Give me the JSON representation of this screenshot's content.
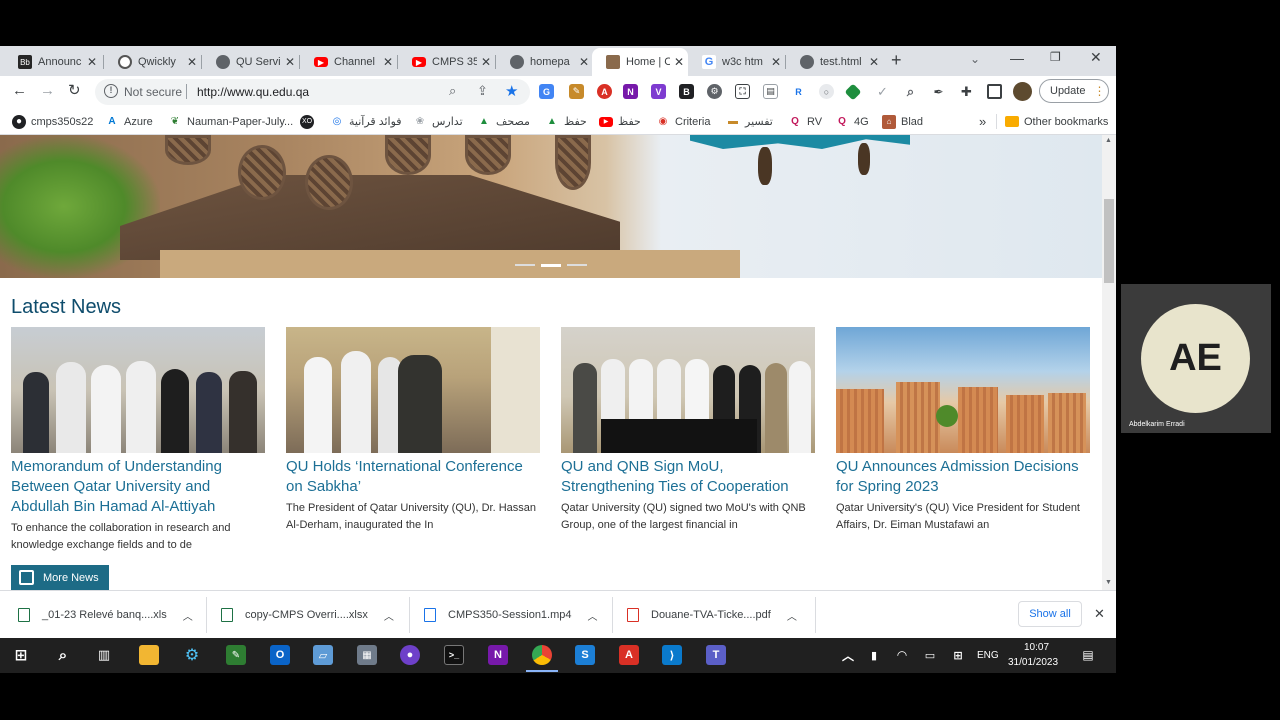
{
  "tabs": [
    {
      "label": "Announc",
      "icon": "bb-icon",
      "color": "#222"
    },
    {
      "label": "Qwickly",
      "icon": "q-icon",
      "color": "#fff"
    },
    {
      "label": "QU Servi",
      "icon": "globe-icon",
      "color": "#5f6368"
    },
    {
      "label": "Channel",
      "icon": "youtube-icon",
      "color": "#ff0000"
    },
    {
      "label": "CMPS 35",
      "icon": "youtube-icon",
      "color": "#ff0000"
    },
    {
      "label": "homepa",
      "icon": "globe-icon",
      "color": "#5f6368"
    },
    {
      "label": "Home | C",
      "icon": "qu-icon",
      "color": "#8a6a4c"
    },
    {
      "label": "w3c htm",
      "icon": "google-icon",
      "color": "#fff"
    },
    {
      "label": "test.html",
      "icon": "globe-icon",
      "color": "#5f6368"
    }
  ],
  "toolbar": {
    "not_secure": "Not secure",
    "url": "http://www.qu.edu.qa",
    "update": "Update"
  },
  "bookmarks": [
    {
      "label": "cmps350s22",
      "icon": "github-icon"
    },
    {
      "label": "Azure",
      "icon": "azure-icon"
    },
    {
      "label": "Nauman-Paper-July...",
      "icon": "leaf-icon"
    },
    {
      "label": "",
      "icon": "xo-icon"
    },
    {
      "label": "فوائد قرآنية",
      "icon": "tajweed-icon"
    },
    {
      "label": "تدارس",
      "icon": "book-icon"
    },
    {
      "label": "مصحف",
      "icon": "mushaf-icon"
    },
    {
      "label": "حفظ",
      "icon": "hifz-icon"
    },
    {
      "label": "حفظ",
      "icon": "youtube-icon"
    },
    {
      "label": "Criteria",
      "icon": "abet-icon"
    },
    {
      "label": "تفسير",
      "icon": "tafsir-icon"
    },
    {
      "label": "RV",
      "icon": "rv-icon"
    },
    {
      "label": "4G",
      "icon": "fourg-icon"
    },
    {
      "label": "Blad",
      "icon": "blad-icon"
    }
  ],
  "other_bookmarks": "Other bookmarks",
  "news": {
    "title": "Latest News",
    "items": [
      {
        "title": "Memorandum of Understanding Between Qatar University and Abdullah Bin Hamad Al-Attiyah",
        "excerpt": "To enhance the collaboration in research and knowledge exchange fields and to de"
      },
      {
        "title": "QU Holds ‘International Conference on Sabkha’",
        "excerpt": "The President of Qatar University (QU), Dr. Hassan Al-Derham, inaugurated the In"
      },
      {
        "title": "QU and QNB Sign MoU, Strengthening Ties of Cooperation",
        "excerpt": "Qatar University (QU) signed two MoU's with QNB Group, one of the largest financial in"
      },
      {
        "title": "QU Announces Admission Decisions for Spring 2023",
        "excerpt": "Qatar University's (QU) Vice President for Student Affairs, Dr. Eiman Mustafawi an"
      }
    ],
    "more": "More News"
  },
  "downloads": {
    "items": [
      {
        "name": "_01-23 Relevé banq....xls",
        "color": "#1e7145"
      },
      {
        "name": "copy-CMPS Overri....xlsx",
        "color": "#1e7145"
      },
      {
        "name": "CMPS350-Session1.mp4",
        "color": "#1a73e8"
      },
      {
        "name": "Douane-TVA-Ticke....pdf",
        "color": "#d93025"
      }
    ],
    "show_all": "Show all"
  },
  "taskbar": {
    "lang": "ENG",
    "time": "10:07",
    "date": "31/01/2023"
  },
  "participant": {
    "initials": "AE",
    "name": "Abdelkarim Erradi"
  }
}
